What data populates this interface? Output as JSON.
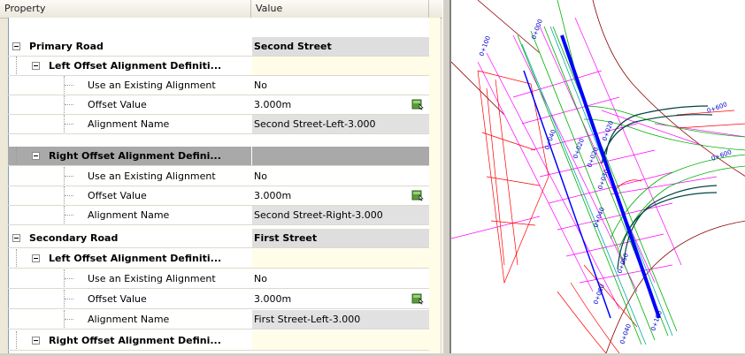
{
  "grid": {
    "header": {
      "property": "Property",
      "value": "Value"
    },
    "rows": [
      {
        "label": "Primary Road",
        "value": "Second Street"
      },
      {
        "label": "Left Offset Alignment Definiti...",
        "value": ""
      },
      {
        "label": "Use an Existing Alignment",
        "value": "No"
      },
      {
        "label": "Offset Value",
        "value": "3.000m"
      },
      {
        "label": "Alignment Name",
        "value": "Second Street-Left-3.000"
      },
      {
        "label": "Right Offset Alignment Defini...",
        "value": ""
      },
      {
        "label": "Use an Existing Alignment",
        "value": "No"
      },
      {
        "label": "Offset Value",
        "value": "3.000m"
      },
      {
        "label": "Alignment Name",
        "value": "Second Street-Right-3.000"
      },
      {
        "label": "Secondary Road",
        "value": "First Street"
      },
      {
        "label": "Left Offset Alignment Definiti...",
        "value": ""
      },
      {
        "label": "Use an Existing Alignment",
        "value": "No"
      },
      {
        "label": "Offset Value",
        "value": "3.000m"
      },
      {
        "label": "Alignment Name",
        "value": "First Street-Left-3.000"
      },
      {
        "label": "Right Offset Alignment Defini...",
        "value": ""
      }
    ]
  },
  "drawing": {
    "stations": [
      "0+100",
      "0+000",
      "0+600",
      "0+040",
      "0+020",
      "0+020",
      "0+030",
      "0+040",
      "0+050",
      "0+060",
      "0+040",
      "0+100",
      "0+600",
      "0+020"
    ],
    "colors": {
      "main_alignment": "#0000ff",
      "offset_lines": "#00b000",
      "grid_lines": "#ff00ff",
      "boundary": "#ff0000",
      "edge": "#8b0000"
    }
  }
}
